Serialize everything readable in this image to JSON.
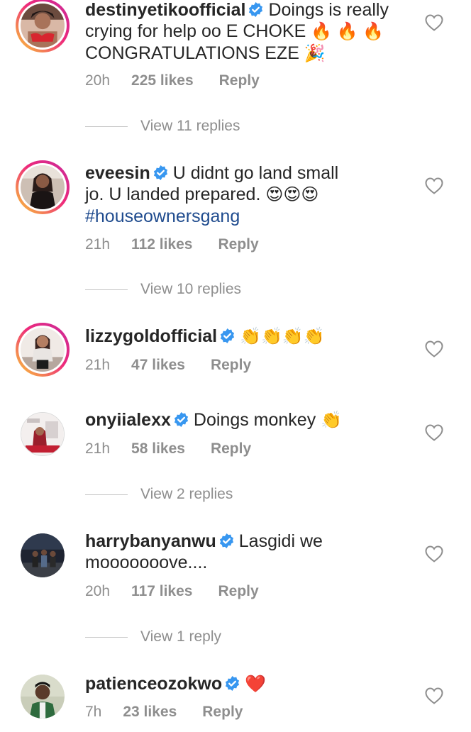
{
  "icons": {
    "verified": "verified-badge-icon",
    "like": "heart-outline-icon",
    "fire": "🔥",
    "party": "🎉",
    "heart_eyes": "😍",
    "clap": "👏",
    "red_heart": "❤️"
  },
  "colors": {
    "verified_blue": "#3897f0",
    "meta_gray": "#8e8e8e",
    "hashtag_blue": "#1f4b8e",
    "heart_red": "#e0245e"
  },
  "comments": [
    {
      "username": "destinyetikoofficial",
      "text_line1": "Doings is really",
      "text_line2": "crying for help oo E CHOKE",
      "emoji_line2": "🔥 🔥 🔥",
      "text_line3": "CONGRATULATIONS EZE",
      "emoji_line3": "🎉",
      "time": "20h",
      "likes": "225 likes",
      "reply": "Reply",
      "view_replies": "View 11 replies"
    },
    {
      "username": "eveesin",
      "text_line1": "U didnt go land small",
      "text_line2": "jo. U landed prepared.",
      "emoji_line2": "😍😍😍",
      "hashtag": "#houseownersgang",
      "time": "21h",
      "likes": "112 likes",
      "reply": "Reply",
      "view_replies": "View 10 replies"
    },
    {
      "username": "lizzygoldofficial",
      "emoji_line1": "👏👏👏👏",
      "time": "21h",
      "likes": "47 likes",
      "reply": "Reply"
    },
    {
      "username": "onyiialexx",
      "text_line1": "Doings monkey",
      "emoji_line1": "👏",
      "time": "21h",
      "likes": "58 likes",
      "reply": "Reply",
      "view_replies": "View 2 replies"
    },
    {
      "username": "harrybanyanwu",
      "text_line1": "Lasgidi we",
      "text_line2": "mooooooove....",
      "time": "20h",
      "likes": "117 likes",
      "reply": "Reply",
      "view_replies": "View 1 reply"
    },
    {
      "username": "patienceozokwo",
      "emoji_line1": "❤️",
      "time": "7h",
      "likes": "23 likes",
      "reply": "Reply"
    }
  ]
}
